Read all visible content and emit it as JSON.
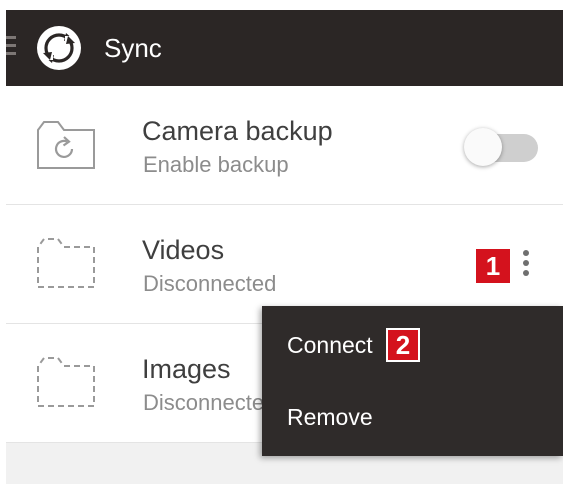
{
  "header": {
    "title": "Sync",
    "logo_icon": "sync-logo-icon",
    "menu_icon": "hamburger-menu-icon"
  },
  "list": {
    "items": [
      {
        "title": "Camera backup",
        "subtitle": "Enable backup",
        "icon": "camera-backup-folder-icon",
        "control": "toggle",
        "toggle_on": false
      },
      {
        "title": "Videos",
        "subtitle": "Disconnected",
        "icon": "disconnected-folder-icon",
        "control": "overflow-menu"
      },
      {
        "title": "Images",
        "subtitle": "Disconnected",
        "icon": "disconnected-folder-icon"
      }
    ]
  },
  "popup_menu": {
    "items": [
      {
        "label": "Connect"
      },
      {
        "label": "Remove"
      }
    ]
  },
  "callouts": {
    "marker_1": "1",
    "marker_2": "2",
    "color": "#d4121d"
  },
  "colors": {
    "appbar": "#2b2625",
    "popup": "#2f2b2a",
    "primary_text": "#3f3f3f",
    "secondary_text": "#8c8c8c"
  }
}
